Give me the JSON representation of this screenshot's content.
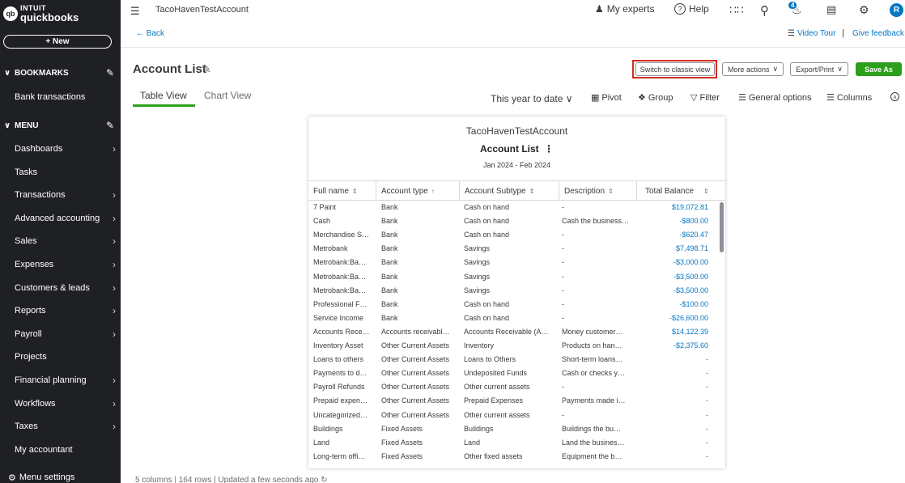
{
  "sidebar": {
    "logo_top": "INTUIT",
    "logo_bottom": "quickbooks",
    "logo_mark": "qb",
    "new_label": "+ New",
    "bookmarks_label": "BOOKMARKS",
    "bookmarks": [
      "Bank transactions"
    ],
    "menu_label": "MENU",
    "menu_items": [
      {
        "label": "Dashboards",
        "arrow": true
      },
      {
        "label": "Tasks",
        "arrow": false
      },
      {
        "label": "Transactions",
        "arrow": true
      },
      {
        "label": "Advanced accounting",
        "arrow": true
      },
      {
        "label": "Sales",
        "arrow": true
      },
      {
        "label": "Expenses",
        "arrow": true
      },
      {
        "label": "Customers & leads",
        "arrow": true
      },
      {
        "label": "Reports",
        "arrow": true
      },
      {
        "label": "Payroll",
        "arrow": true
      },
      {
        "label": "Projects",
        "arrow": false
      },
      {
        "label": "Financial planning",
        "arrow": true
      },
      {
        "label": "Workflows",
        "arrow": true
      },
      {
        "label": "Taxes",
        "arrow": true
      },
      {
        "label": "My accountant",
        "arrow": false
      }
    ],
    "settings_label": "Menu settings"
  },
  "topbar": {
    "company": "TacoHavenTestAccount",
    "my_experts": "My experts",
    "help": "Help",
    "notifications_count": "4",
    "avatar_initial": "R"
  },
  "nav": {
    "back": "Back",
    "video_tour": "Video Tour",
    "separator": "|",
    "give_feedback": "Give feedback"
  },
  "page": {
    "title": "Account List",
    "switch_classic": "Switch to classic view",
    "more_actions": "More actions",
    "export_print": "Export/Print",
    "save_as": "Save As",
    "tabs": [
      "Table View",
      "Chart View"
    ],
    "period": "This year to date",
    "tools": {
      "pivot": "Pivot",
      "group": "Group",
      "filter": "Filter",
      "general_options": "General options",
      "columns": "Columns"
    },
    "footer": "5 columns | 164 rows | Updated a few seconds ago"
  },
  "report": {
    "company": "TacoHavenTestAccount",
    "title": "Account List",
    "period": "Jan 2024 - Feb 2024",
    "columns": [
      "Full name",
      "Account type",
      "Account Subtype",
      "Description",
      "Total Balance"
    ],
    "rows": [
      [
        "7 Paint",
        "Bank",
        "Cash on hand",
        "-",
        "$19,072.81"
      ],
      [
        "Cash",
        "Bank",
        "Cash on hand",
        "Cash the business…",
        "-$800.00"
      ],
      [
        "Merchandise S…",
        "Bank",
        "Cash on hand",
        "-",
        "-$620.47"
      ],
      [
        "Metrobank",
        "Bank",
        "Savings",
        "-",
        "$7,498.71"
      ],
      [
        "Metrobank:Ba…",
        "Bank",
        "Savings",
        "-",
        "-$3,000.00"
      ],
      [
        "Metrobank:Ba…",
        "Bank",
        "Savings",
        "-",
        "-$3,500.00"
      ],
      [
        "Metrobank:Ba…",
        "Bank",
        "Savings",
        "-",
        "-$3,500.00"
      ],
      [
        "Professional F…",
        "Bank",
        "Cash on hand",
        "-",
        "-$100.00"
      ],
      [
        "Service Income",
        "Bank",
        "Cash on hand",
        "-",
        "-$26,600.00"
      ],
      [
        "Accounts Rece…",
        "Accounts receivabl…",
        "Accounts Receivable (A…",
        "Money customer…",
        "$14,122.39"
      ],
      [
        "Inventory Asset",
        "Other Current Assets",
        "Inventory",
        "Products on han…",
        "-$2,375.60"
      ],
      [
        "Loans to others",
        "Other Current Assets",
        "Loans to Others",
        "Short-term loans…",
        "-"
      ],
      [
        "Payments to d…",
        "Other Current Assets",
        "Undeposited Funds",
        "Cash or checks y…",
        "-"
      ],
      [
        "Payroll Refunds",
        "Other Current Assets",
        "Other current assets",
        "-",
        "-"
      ],
      [
        "Prepaid expen…",
        "Other Current Assets",
        "Prepaid Expenses",
        "Payments made i…",
        "-"
      ],
      [
        "Uncategorized…",
        "Other Current Assets",
        "Other current assets",
        "-",
        "-"
      ],
      [
        "Buildings",
        "Fixed Assets",
        "Buildings",
        "Buildings the bu…",
        "-"
      ],
      [
        "Land",
        "Fixed Assets",
        "Land",
        "Land the busines…",
        "-"
      ],
      [
        "Long-term offi…",
        "Fixed Assets",
        "Other fixed assets",
        "Equipment the b…",
        "-"
      ]
    ]
  },
  "colors": {
    "sidebar_bg": "#1f2024",
    "accent_green": "#2ca01c",
    "link_blue": "#0077c5",
    "highlight_red": "#d52b1e"
  }
}
